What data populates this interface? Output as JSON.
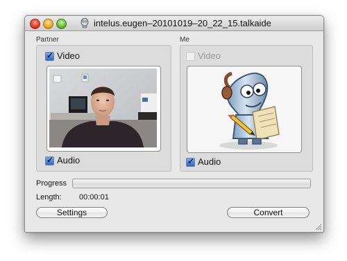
{
  "window": {
    "title": "intelus.eugen–20101019–20_22_15.talkaide"
  },
  "partner": {
    "group_label": "Partner",
    "video_label": "Video",
    "video_checked": true,
    "audio_label": "Audio",
    "audio_checked": true
  },
  "me": {
    "group_label": "Me",
    "video_label": "Video",
    "video_checked": false,
    "video_enabled": false,
    "audio_label": "Audio",
    "audio_checked": true
  },
  "progress": {
    "label": "Progress",
    "value": 0
  },
  "length": {
    "label": "Length:",
    "value": "00:00:01"
  },
  "buttons": {
    "settings": "Settings",
    "convert": "Convert"
  },
  "colors": {
    "window_bg": "#e8e8e8",
    "group_bg": "#dcdcdc",
    "checkbox_accent": "#3a75d4"
  }
}
